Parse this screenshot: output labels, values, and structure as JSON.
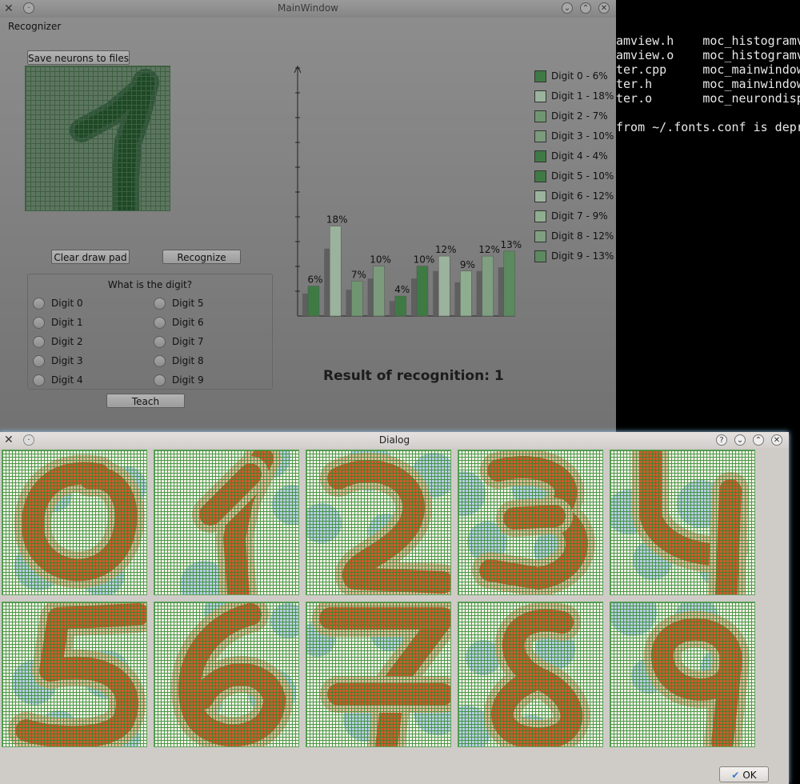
{
  "terminal": {
    "lines": [
      "amview.h    moc_histogramv",
      "amview.o    moc_histogramv",
      "ter.cpp     moc_mainwindow",
      "ter.h       moc_mainwindow",
      "ter.o       moc_neurondisp",
      "",
      "from ~/.fonts.conf is depr"
    ]
  },
  "main_window": {
    "title": "MainWindow",
    "menu": "Recognizer",
    "save_button": "Save neurons to files",
    "clear_button": "Clear draw pad",
    "recognize_button": "Recognize",
    "group_title": "What is the digit?",
    "radios": [
      "Digit 0",
      "Digit 1",
      "Digit 2",
      "Digit 3",
      "Digit 4",
      "Digit 5",
      "Digit 6",
      "Digit 7",
      "Digit 8",
      "Digit 9"
    ],
    "teach_button": "Teach",
    "result": "Result of recognition: 1"
  },
  "chart_data": {
    "type": "bar",
    "categories": [
      "Digit 0",
      "Digit 1",
      "Digit 2",
      "Digit 3",
      "Digit 4",
      "Digit 5",
      "Digit 6",
      "Digit 7",
      "Digit 8",
      "Digit 9"
    ],
    "values": [
      6,
      18,
      7,
      10,
      4,
      10,
      12,
      9,
      12,
      13
    ],
    "labels": [
      "6%",
      "18%",
      "7%",
      "10%",
      "4%",
      "10%",
      "12%",
      "9%",
      "12%",
      "13%"
    ],
    "legend": [
      "Digit 0 - 6%",
      "Digit 1 - 18%",
      "Digit 2 - 7%",
      "Digit 3 - 10%",
      "Digit 4 - 4%",
      "Digit 5 - 10%",
      "Digit 6 - 12%",
      "Digit 7 - 9%",
      "Digit 8 - 12%",
      "Digit 9 - 13%"
    ],
    "colors": [
      "#3f7a45",
      "#9bb39c",
      "#6f9670",
      "#7b9b7c",
      "#3f7a45",
      "#3f7a45",
      "#9bb39c",
      "#8fae90",
      "#7f9f80",
      "#5c8a5f"
    ],
    "legend_position": "right"
  },
  "dialog": {
    "title": "Dialog",
    "ok_button": "OK"
  }
}
